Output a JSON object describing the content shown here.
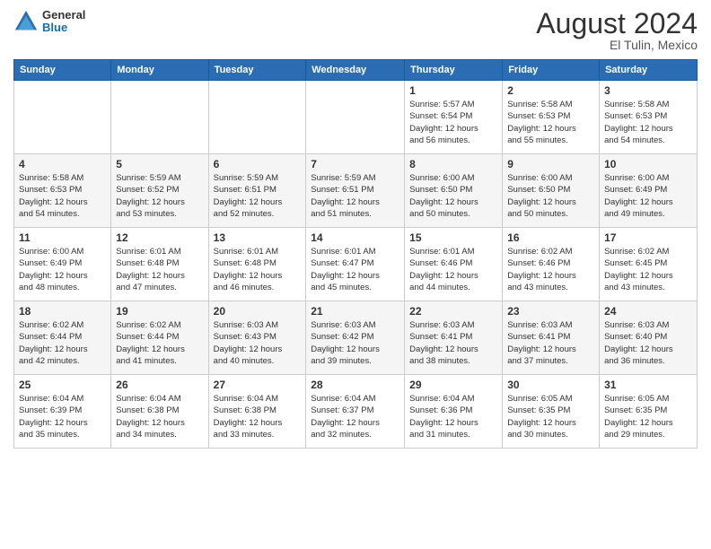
{
  "header": {
    "logo": {
      "general": "General",
      "blue": "Blue"
    },
    "title": "August 2024",
    "location": "El Tulin, Mexico"
  },
  "calendar": {
    "weekdays": [
      "Sunday",
      "Monday",
      "Tuesday",
      "Wednesday",
      "Thursday",
      "Friday",
      "Saturday"
    ],
    "weeks": [
      [
        {
          "day": "",
          "info": ""
        },
        {
          "day": "",
          "info": ""
        },
        {
          "day": "",
          "info": ""
        },
        {
          "day": "",
          "info": ""
        },
        {
          "day": "1",
          "info": "Sunrise: 5:57 AM\nSunset: 6:54 PM\nDaylight: 12 hours\nand 56 minutes."
        },
        {
          "day": "2",
          "info": "Sunrise: 5:58 AM\nSunset: 6:53 PM\nDaylight: 12 hours\nand 55 minutes."
        },
        {
          "day": "3",
          "info": "Sunrise: 5:58 AM\nSunset: 6:53 PM\nDaylight: 12 hours\nand 54 minutes."
        }
      ],
      [
        {
          "day": "4",
          "info": "Sunrise: 5:58 AM\nSunset: 6:53 PM\nDaylight: 12 hours\nand 54 minutes."
        },
        {
          "day": "5",
          "info": "Sunrise: 5:59 AM\nSunset: 6:52 PM\nDaylight: 12 hours\nand 53 minutes."
        },
        {
          "day": "6",
          "info": "Sunrise: 5:59 AM\nSunset: 6:51 PM\nDaylight: 12 hours\nand 52 minutes."
        },
        {
          "day": "7",
          "info": "Sunrise: 5:59 AM\nSunset: 6:51 PM\nDaylight: 12 hours\nand 51 minutes."
        },
        {
          "day": "8",
          "info": "Sunrise: 6:00 AM\nSunset: 6:50 PM\nDaylight: 12 hours\nand 50 minutes."
        },
        {
          "day": "9",
          "info": "Sunrise: 6:00 AM\nSunset: 6:50 PM\nDaylight: 12 hours\nand 50 minutes."
        },
        {
          "day": "10",
          "info": "Sunrise: 6:00 AM\nSunset: 6:49 PM\nDaylight: 12 hours\nand 49 minutes."
        }
      ],
      [
        {
          "day": "11",
          "info": "Sunrise: 6:00 AM\nSunset: 6:49 PM\nDaylight: 12 hours\nand 48 minutes."
        },
        {
          "day": "12",
          "info": "Sunrise: 6:01 AM\nSunset: 6:48 PM\nDaylight: 12 hours\nand 47 minutes."
        },
        {
          "day": "13",
          "info": "Sunrise: 6:01 AM\nSunset: 6:48 PM\nDaylight: 12 hours\nand 46 minutes."
        },
        {
          "day": "14",
          "info": "Sunrise: 6:01 AM\nSunset: 6:47 PM\nDaylight: 12 hours\nand 45 minutes."
        },
        {
          "day": "15",
          "info": "Sunrise: 6:01 AM\nSunset: 6:46 PM\nDaylight: 12 hours\nand 44 minutes."
        },
        {
          "day": "16",
          "info": "Sunrise: 6:02 AM\nSunset: 6:46 PM\nDaylight: 12 hours\nand 43 minutes."
        },
        {
          "day": "17",
          "info": "Sunrise: 6:02 AM\nSunset: 6:45 PM\nDaylight: 12 hours\nand 43 minutes."
        }
      ],
      [
        {
          "day": "18",
          "info": "Sunrise: 6:02 AM\nSunset: 6:44 PM\nDaylight: 12 hours\nand 42 minutes."
        },
        {
          "day": "19",
          "info": "Sunrise: 6:02 AM\nSunset: 6:44 PM\nDaylight: 12 hours\nand 41 minutes."
        },
        {
          "day": "20",
          "info": "Sunrise: 6:03 AM\nSunset: 6:43 PM\nDaylight: 12 hours\nand 40 minutes."
        },
        {
          "day": "21",
          "info": "Sunrise: 6:03 AM\nSunset: 6:42 PM\nDaylight: 12 hours\nand 39 minutes."
        },
        {
          "day": "22",
          "info": "Sunrise: 6:03 AM\nSunset: 6:41 PM\nDaylight: 12 hours\nand 38 minutes."
        },
        {
          "day": "23",
          "info": "Sunrise: 6:03 AM\nSunset: 6:41 PM\nDaylight: 12 hours\nand 37 minutes."
        },
        {
          "day": "24",
          "info": "Sunrise: 6:03 AM\nSunset: 6:40 PM\nDaylight: 12 hours\nand 36 minutes."
        }
      ],
      [
        {
          "day": "25",
          "info": "Sunrise: 6:04 AM\nSunset: 6:39 PM\nDaylight: 12 hours\nand 35 minutes."
        },
        {
          "day": "26",
          "info": "Sunrise: 6:04 AM\nSunset: 6:38 PM\nDaylight: 12 hours\nand 34 minutes."
        },
        {
          "day": "27",
          "info": "Sunrise: 6:04 AM\nSunset: 6:38 PM\nDaylight: 12 hours\nand 33 minutes."
        },
        {
          "day": "28",
          "info": "Sunrise: 6:04 AM\nSunset: 6:37 PM\nDaylight: 12 hours\nand 32 minutes."
        },
        {
          "day": "29",
          "info": "Sunrise: 6:04 AM\nSunset: 6:36 PM\nDaylight: 12 hours\nand 31 minutes."
        },
        {
          "day": "30",
          "info": "Sunrise: 6:05 AM\nSunset: 6:35 PM\nDaylight: 12 hours\nand 30 minutes."
        },
        {
          "day": "31",
          "info": "Sunrise: 6:05 AM\nSunset: 6:35 PM\nDaylight: 12 hours\nand 29 minutes."
        }
      ]
    ]
  }
}
